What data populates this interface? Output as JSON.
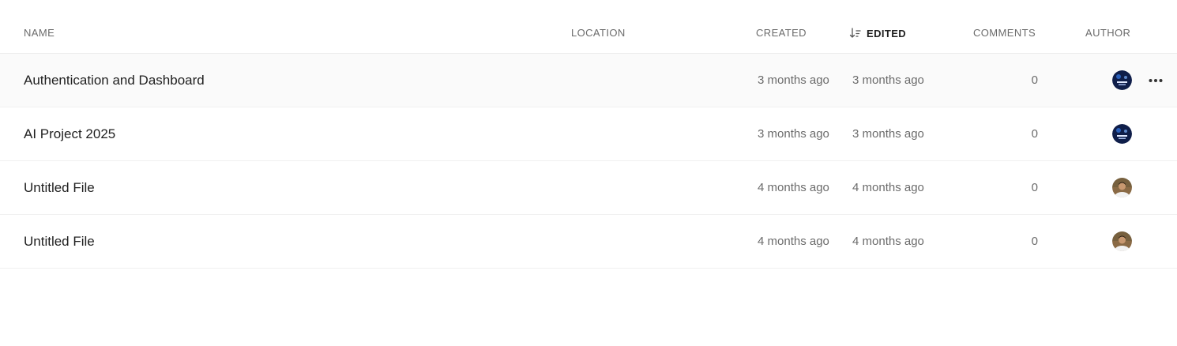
{
  "columns": {
    "name": "NAME",
    "location": "LOCATION",
    "created": "CREATED",
    "edited": "EDITED",
    "comments": "COMMENTS",
    "author": "AUTHOR"
  },
  "sort": {
    "column": "edited",
    "direction": "descending",
    "icon": "sort-descending-icon"
  },
  "colors": {
    "text": "#1f1f1f",
    "muted": "#6b6b6b",
    "row_hover": "#fafafa",
    "divider": "#f0f0f0"
  },
  "files": [
    {
      "name": "Authentication and Dashboard",
      "location": "",
      "created": "3 months ago",
      "edited": "3 months ago",
      "comments": "0",
      "author_avatar": "dark-blue-avatar",
      "hovered": true
    },
    {
      "name": "AI Project 2025",
      "location": "",
      "created": "3 months ago",
      "edited": "3 months ago",
      "comments": "0",
      "author_avatar": "dark-blue-avatar",
      "hovered": false
    },
    {
      "name": "Untitled File",
      "location": "",
      "created": "4 months ago",
      "edited": "4 months ago",
      "comments": "0",
      "author_avatar": "person-photo-avatar",
      "hovered": false
    },
    {
      "name": "Untitled File",
      "location": "",
      "created": "4 months ago",
      "edited": "4 months ago",
      "comments": "0",
      "author_avatar": "person-photo-avatar",
      "hovered": false
    }
  ],
  "row_actions": {
    "icon": "more-horizontal-icon"
  }
}
